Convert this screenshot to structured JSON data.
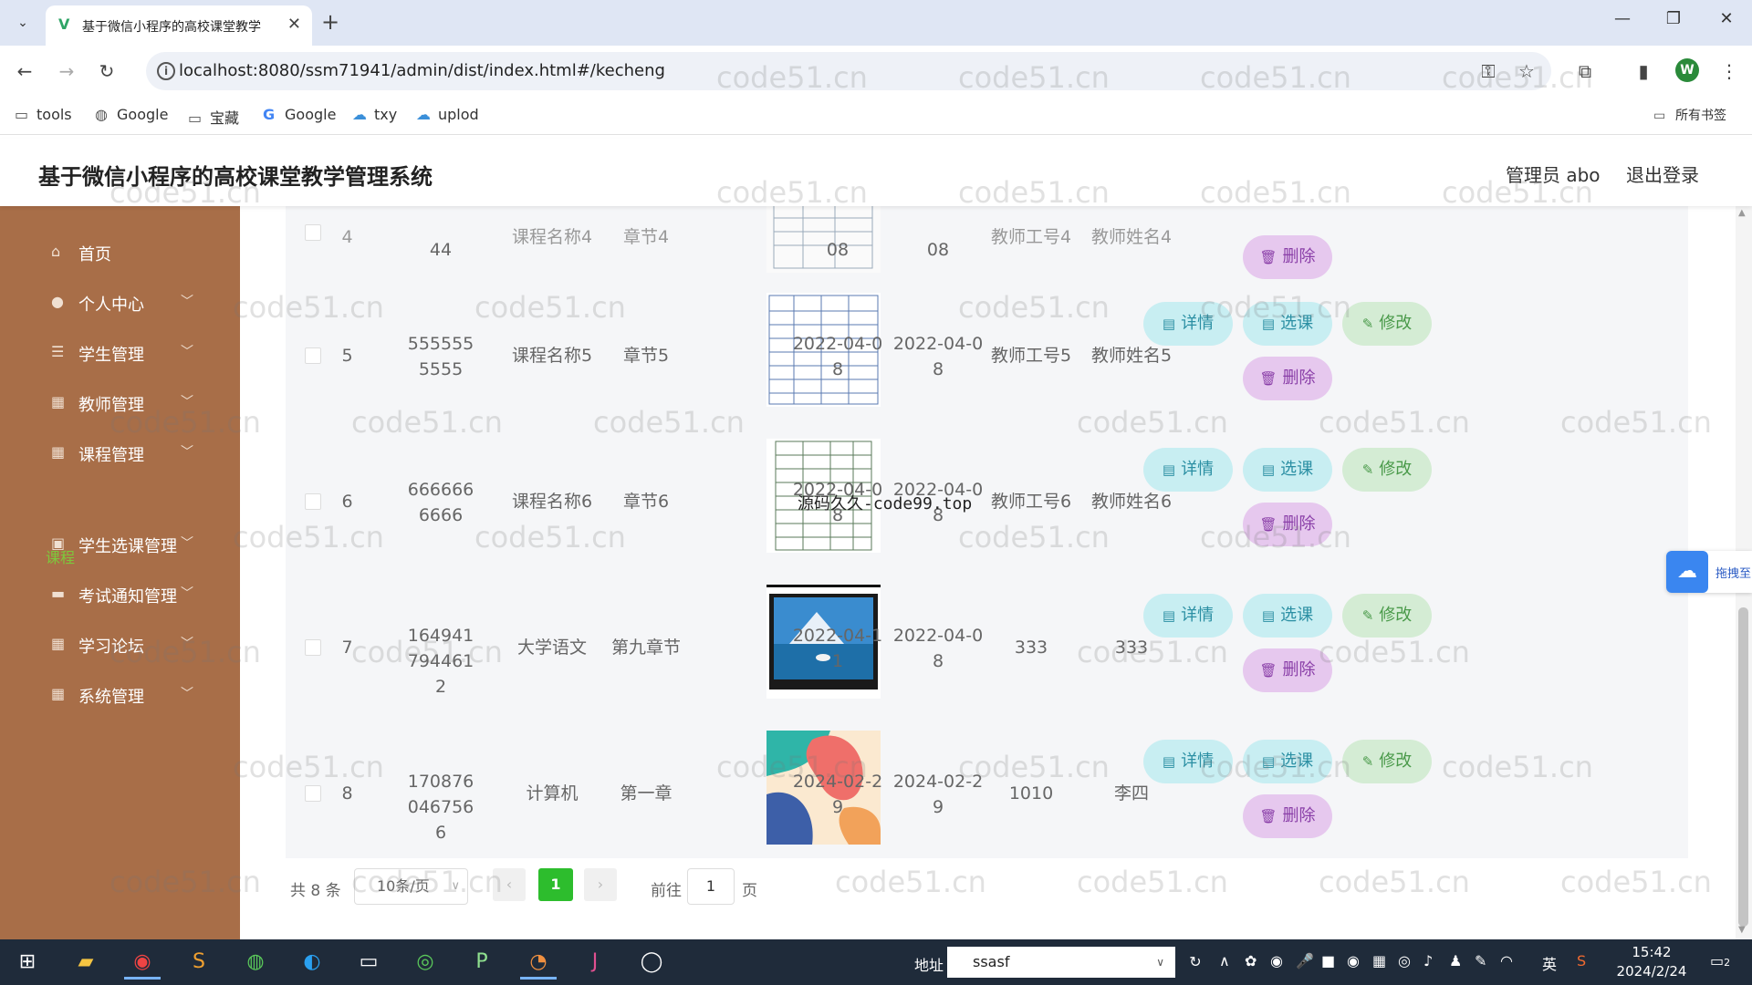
{
  "browser": {
    "tab_title": "基于微信小程序的高校课堂教学",
    "url": "localhost:8080/ssm71941/admin/dist/index.html#/kecheng",
    "bookmarks": [
      {
        "label": "tools",
        "icon": "folder-icon"
      },
      {
        "label": "Google",
        "icon": "globe-icon"
      },
      {
        "label": "宝藏",
        "icon": "folder-icon"
      },
      {
        "label": "Google",
        "icon": "google-icon"
      },
      {
        "label": "txy",
        "icon": "cloud-icon"
      },
      {
        "label": "uplod",
        "icon": "cloud-icon"
      }
    ],
    "all_bookmarks": "所有书签",
    "profile_initial": "W"
  },
  "header": {
    "title": "基于微信小程序的高校课堂教学管理系统",
    "admin": "管理员 abo",
    "logout": "退出登录"
  },
  "sidebar": {
    "items": [
      {
        "label": "首页",
        "icon": "home-icon"
      },
      {
        "label": "个人中心",
        "icon": "user-icon"
      },
      {
        "label": "学生管理",
        "icon": "list-icon"
      },
      {
        "label": "教师管理",
        "icon": "grid-icon"
      },
      {
        "label": "课程管理",
        "icon": "grid-icon"
      },
      {
        "label": "学生选课管理",
        "icon": "image-icon"
      },
      {
        "label": "考试通知管理",
        "icon": "monitor-icon"
      },
      {
        "label": "学习论坛",
        "icon": "grid-icon"
      },
      {
        "label": "系统管理",
        "icon": "grid-icon"
      }
    ],
    "active_sub": "课程"
  },
  "table": {
    "partial_row": {
      "index": "4",
      "code": "44",
      "name": "课程名称4",
      "chapter": "章节4",
      "start": "08",
      "end": "08",
      "teacher_no": "教师工号4",
      "teacher_name": "教师姓名4"
    },
    "rows": [
      {
        "index": "5",
        "code": "5555555555",
        "name": "课程名称5",
        "chapter": "章节5",
        "start": "2022-04-08",
        "end": "2022-04-08",
        "teacher_no": "教师工号5",
        "teacher_name": "教师姓名5"
      },
      {
        "index": "6",
        "code": "6666666666",
        "name": "课程名称6",
        "chapter": "章节6",
        "start": "2022-04-08",
        "end": "2022-04-08",
        "teacher_no": "教师工号6",
        "teacher_name": "教师姓名6"
      },
      {
        "index": "7",
        "code": "1649417944612",
        "name": "大学语文",
        "chapter": "第九章节",
        "start": "2022-04-11",
        "end": "2022-04-08",
        "teacher_no": "333",
        "teacher_name": "333"
      },
      {
        "index": "8",
        "code": "1708760467566",
        "name": "计算机",
        "chapter": "第一章",
        "start": "2024-02-29",
        "end": "2024-02-29",
        "teacher_no": "1010",
        "teacher_name": "李四"
      }
    ],
    "actions": {
      "detail": "详情",
      "select": "选课",
      "edit": "修改",
      "delete": "删除"
    }
  },
  "pagination": {
    "total": "共 8 条",
    "page_size": "10条/页",
    "current": "1",
    "goto_label": "前往",
    "goto_value": "1",
    "unit": "页"
  },
  "overlay_text": "源码久久-code99.top",
  "watermark": "code51.cn",
  "float_widget": "拖拽至",
  "taskbar": {
    "addr_label": "地址",
    "addr_value": "ssasf",
    "ime": "英",
    "time": "15:42",
    "date": "2024/2/24",
    "notifications": "2"
  }
}
